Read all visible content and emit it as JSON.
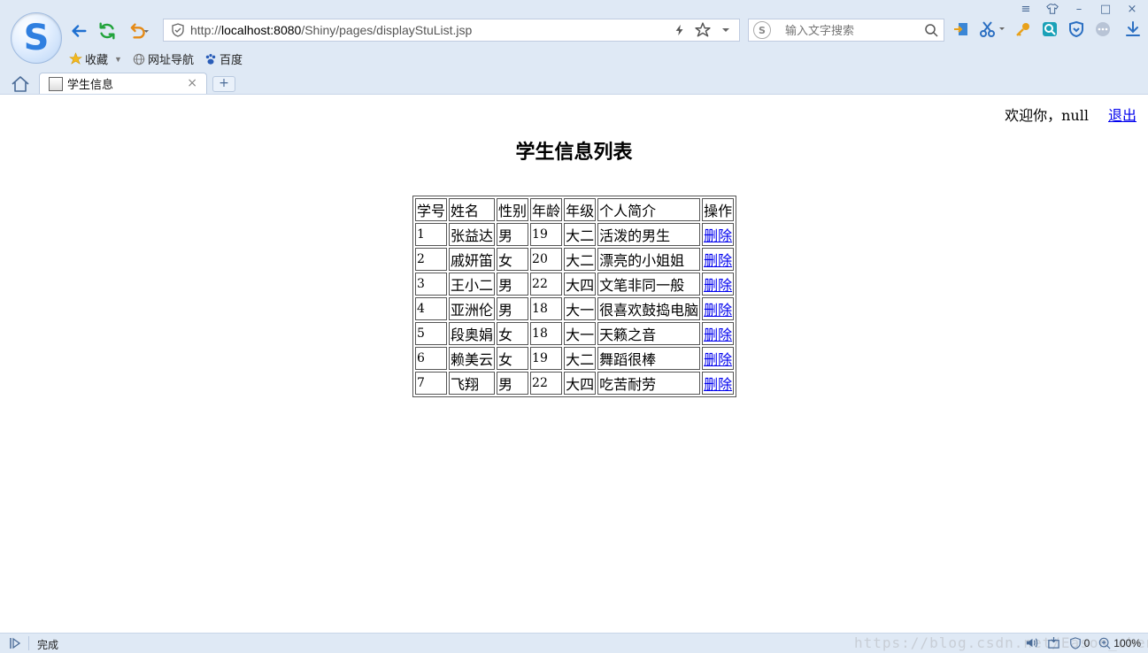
{
  "browser": {
    "url_prefix": "http://",
    "url_host": "localhost:8080",
    "url_path": "/Shiny/pages/displayStuList.jsp",
    "search_placeholder": "输入文字搜索",
    "bookmarks": [
      "收藏",
      "网址导航",
      "百度"
    ],
    "tab_title": "学生信息",
    "tab_close": "×",
    "new_tab": "+",
    "status_text": "完成",
    "watermark": "https://blog.csdn.net/Eason_chen",
    "zoom": "100%",
    "shield_count": "0"
  },
  "page": {
    "welcome": "欢迎你，null",
    "logout": "退出",
    "title": "学生信息列表"
  },
  "table": {
    "headers": [
      "学号",
      "姓名",
      "性别",
      "年龄",
      "年级",
      "个人简介",
      "操作"
    ],
    "rows": [
      [
        "1",
        "张益达",
        "男",
        "19",
        "大二",
        "活泼的男生",
        "删除"
      ],
      [
        "2",
        "戚妍笛",
        "女",
        "20",
        "大二",
        "漂亮的小姐姐",
        "删除"
      ],
      [
        "3",
        "王小二",
        "男",
        "22",
        "大四",
        "文笔非同一般",
        "删除"
      ],
      [
        "4",
        "亚洲伦",
        "男",
        "18",
        "大一",
        "很喜欢鼓捣电脑",
        "删除"
      ],
      [
        "5",
        "段奥娟",
        "女",
        "18",
        "大一",
        "天籁之音",
        "删除"
      ],
      [
        "6",
        "赖美云",
        "女",
        "19",
        "大二",
        "舞蹈很棒",
        "删除"
      ],
      [
        "7",
        "飞翔",
        "男",
        "22",
        "大四",
        "吃苦耐劳",
        "删除"
      ]
    ]
  }
}
